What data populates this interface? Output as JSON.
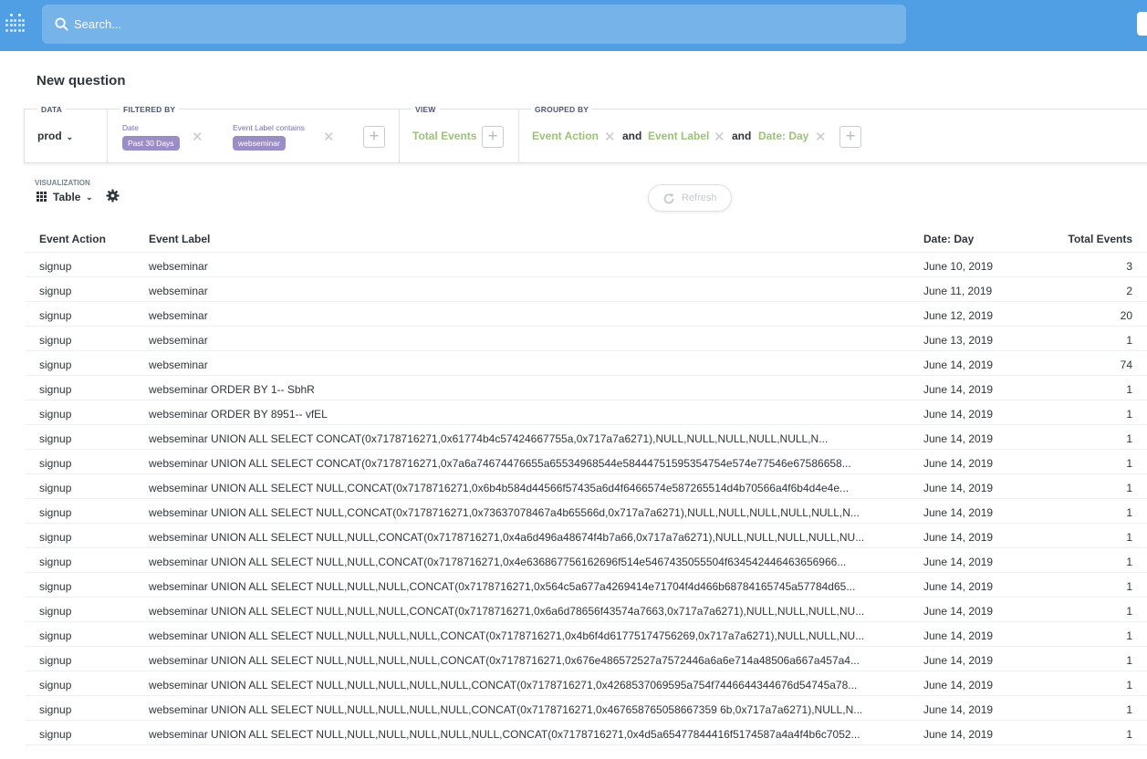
{
  "nav": {
    "search_placeholder": "Search..."
  },
  "page": {
    "title": "New question"
  },
  "query": {
    "data_label": "DATA",
    "data_source": "prod",
    "filtered_by_label": "FILTERED BY",
    "filters": [
      {
        "label": "Date",
        "value": "Past 30 Days"
      },
      {
        "label": "Event Label contains",
        "value": "webseminar"
      }
    ],
    "view_label": "VIEW",
    "view_metric": "Total Events",
    "grouped_by_label": "GROUPED BY",
    "groups": [
      "Event Action",
      "Event Label",
      "Date: Day"
    ],
    "and_word": "and"
  },
  "visualization": {
    "label": "VISUALIZATION",
    "type": "Table",
    "refresh_label": "Refresh"
  },
  "table": {
    "columns": [
      "Event Action",
      "Event Label",
      "Date: Day",
      "Total Events"
    ],
    "rows": [
      [
        "signup",
        "webseminar",
        "June 10, 2019",
        "3"
      ],
      [
        "signup",
        "webseminar",
        "June 11, 2019",
        "2"
      ],
      [
        "signup",
        "webseminar",
        "June 12, 2019",
        "20"
      ],
      [
        "signup",
        "webseminar",
        "June 13, 2019",
        "1"
      ],
      [
        "signup",
        "webseminar",
        "June 14, 2019",
        "74"
      ],
      [
        "signup",
        "webseminar ORDER BY 1-- SbhR",
        "June 14, 2019",
        "1"
      ],
      [
        "signup",
        "webseminar ORDER BY 8951-- vfEL",
        "June 14, 2019",
        "1"
      ],
      [
        "signup",
        "webseminar UNION ALL SELECT CONCAT(0x7178716271,0x61774b4c57424667755a,0x717a7a6271),NULL,NULL,NULL,NULL,NULL,N...",
        "June 14, 2019",
        "1"
      ],
      [
        "signup",
        "webseminar UNION ALL SELECT CONCAT(0x7178716271,0x7a6a74674476655a65534968544e58444751595354754e574e77546e67586658...",
        "June 14, 2019",
        "1"
      ],
      [
        "signup",
        "webseminar UNION ALL SELECT NULL,CONCAT(0x7178716271,0x6b4b584d44566f57435a6d4f6466574e587265514d4b70566a4f6b4d4e4e...",
        "June 14, 2019",
        "1"
      ],
      [
        "signup",
        "webseminar UNION ALL SELECT NULL,CONCAT(0x7178716271,0x73637078467a4b65566d,0x717a7a6271),NULL,NULL,NULL,NULL,NULL,N...",
        "June 14, 2019",
        "1"
      ],
      [
        "signup",
        "webseminar UNION ALL SELECT NULL,NULL,CONCAT(0x7178716271,0x4a6d496a48674f4b7a66,0x717a7a6271),NULL,NULL,NULL,NULL,NU...",
        "June 14, 2019",
        "1"
      ],
      [
        "signup",
        "webseminar UNION ALL SELECT NULL,NULL,CONCAT(0x7178716271,0x4e636867756162696f514e5467435055504f634542446463656966...",
        "June 14, 2019",
        "1"
      ],
      [
        "signup",
        "webseminar UNION ALL SELECT NULL,NULL,NULL,CONCAT(0x7178716271,0x564c5a677a4269414e71704f4d466b68784165745a57784d65...",
        "June 14, 2019",
        "1"
      ],
      [
        "signup",
        "webseminar UNION ALL SELECT NULL,NULL,NULL,CONCAT(0x7178716271,0x6a6d78656f43574a7663,0x717a7a6271),NULL,NULL,NULL,NU...",
        "June 14, 2019",
        "1"
      ],
      [
        "signup",
        "webseminar UNION ALL SELECT NULL,NULL,NULL,NULL,CONCAT(0x7178716271,0x4b6f4d61775174756269,0x717a7a6271),NULL,NULL,NU...",
        "June 14, 2019",
        "1"
      ],
      [
        "signup",
        "webseminar UNION ALL SELECT NULL,NULL,NULL,NULL,CONCAT(0x7178716271,0x676e486572527a7572446a6a6e714a48506a667a457a4...",
        "June 14, 2019",
        "1"
      ],
      [
        "signup",
        "webseminar UNION ALL SELECT NULL,NULL,NULL,NULL,NULL,CONCAT(0x7178716271,0x4268537069595a754f7446644344676d54745a78...",
        "June 14, 2019",
        "1"
      ],
      [
        "signup",
        "webseminar UNION ALL SELECT NULL,NULL,NULL,NULL,NULL,CONCAT(0x7178716271,0x467658765058667359 6b,0x717a7a6271),NULL,N...",
        "June 14, 2019",
        "1"
      ],
      [
        "signup",
        "webseminar UNION ALL SELECT NULL,NULL,NULL,NULL,NULL,NULL,CONCAT(0x7178716271,0x4d5a65477844416f5174587a4a4f4b6c7052...",
        "June 14, 2019",
        "1"
      ]
    ]
  },
  "colors": {
    "nav_bg": "#509ee3",
    "filter_pill": "#9b8ec6",
    "filter_label": "#7172ad",
    "metric_green": "#9cc177"
  }
}
